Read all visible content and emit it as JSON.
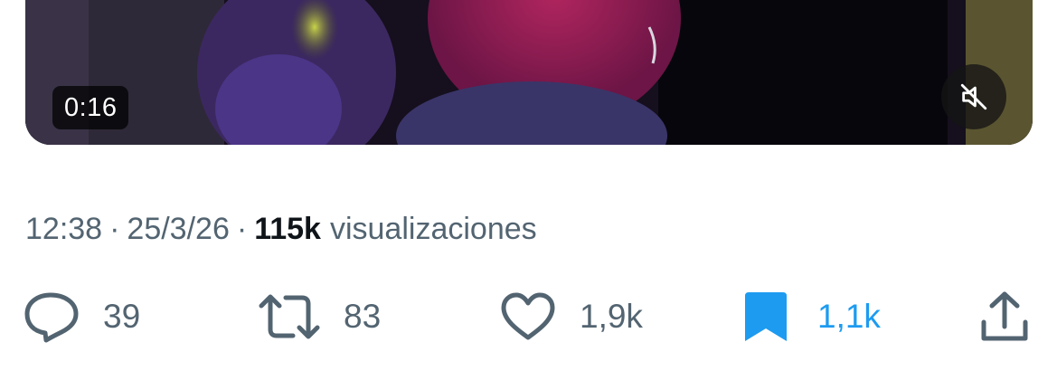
{
  "video": {
    "duration": "0:16",
    "mute_icon": "speaker-muted-icon"
  },
  "meta": {
    "time": "12:38",
    "separator": "·",
    "date": "25/3/26",
    "views_count": "115k",
    "views_label": "visualizaciones"
  },
  "actions": {
    "reply": {
      "icon": "comment-icon",
      "count": "39"
    },
    "repost": {
      "icon": "repost-icon",
      "count": "83"
    },
    "like": {
      "icon": "heart-icon",
      "count": "1,9k"
    },
    "bookmark": {
      "icon": "bookmark-filled-icon",
      "count": "1,1k",
      "active": true
    },
    "share": {
      "icon": "share-icon"
    }
  },
  "colors": {
    "text_secondary": "#536471",
    "text_primary": "#0f1419",
    "accent": "#1d9bf0"
  }
}
